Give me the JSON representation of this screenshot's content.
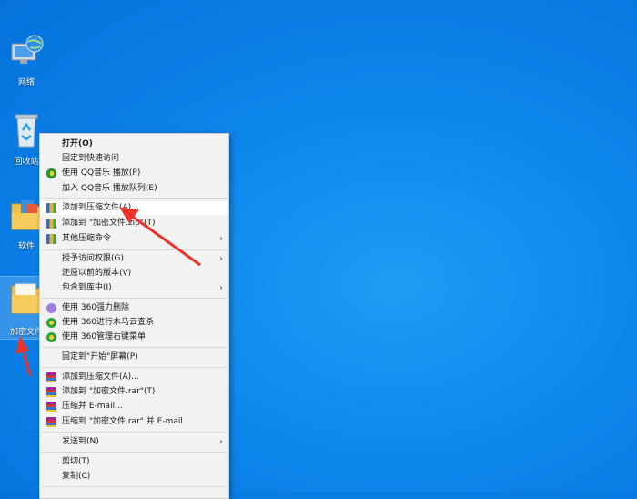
{
  "desktop": {
    "icons": [
      {
        "label": "网络",
        "name": "network-icon"
      },
      {
        "label": "回收站",
        "name": "recycle-bin-icon"
      },
      {
        "label": "软件",
        "name": "software-folder-icon"
      },
      {
        "label": "加密文件",
        "name": "encrypted-folder-icon"
      }
    ]
  },
  "context_menu": {
    "items": [
      {
        "label": "打开(O)",
        "bold": true
      },
      {
        "label": "固定到快速访问"
      },
      {
        "label": "使用 QQ音乐 播放(P)",
        "icon": "qq-music-icon"
      },
      {
        "label": "加入 QQ音乐 播放队列(E)"
      },
      {
        "label": "添加到压缩文件(A)...",
        "icon": "bandizip-icon"
      },
      {
        "label": "添加到 \"加密文件.zip\"(T)",
        "icon": "bandizip-icon"
      },
      {
        "label": "其他压缩命令",
        "icon": "bandizip-icon"
      },
      {
        "label": "授予访问权限(G)"
      },
      {
        "label": "还原以前的版本(V)"
      },
      {
        "label": "包含到库中(I)"
      },
      {
        "label": "使用 360强力删除",
        "icon": "360-shred-icon"
      },
      {
        "label": "使用 360进行木马云查杀",
        "icon": "360-scan-icon"
      },
      {
        "label": "使用 360管理右键菜单",
        "icon": "360-scan-icon"
      },
      {
        "label": "固定到\"开始\"屏幕(P)"
      },
      {
        "label": "添加到压缩文件(A)...",
        "icon": "winrar-icon"
      },
      {
        "label": "添加到 \"加密文件.rar\"(T)",
        "icon": "winrar-icon"
      },
      {
        "label": "压缩并 E-mail...",
        "icon": "winrar-icon"
      },
      {
        "label": "压缩到 \"加密文件.rar\" 并 E-mail",
        "icon": "winrar-icon"
      },
      {
        "label": "发送到(N)"
      },
      {
        "label": "剪切(T)"
      },
      {
        "label": "复制(C)"
      }
    ]
  },
  "colors": {
    "annotation_arrow": "#e8342b",
    "desktop_bg": "#0d86ec"
  }
}
